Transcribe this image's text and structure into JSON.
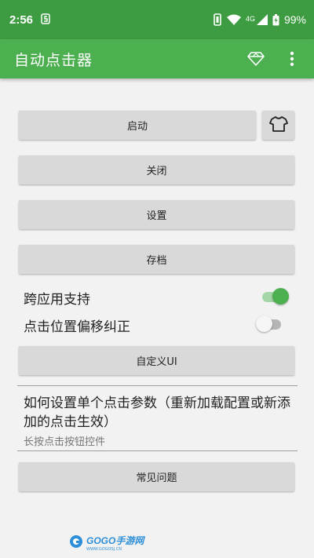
{
  "status_bar": {
    "time": "2:56",
    "notification_icon": "s-icon",
    "network": "4G",
    "battery": "99%",
    "icons": [
      "vibrate-icon",
      "wifi-icon",
      "signal-icon",
      "battery-icon"
    ]
  },
  "app_bar": {
    "title": "自动点击器",
    "actions": [
      "diamond-icon",
      "more-vert-icon"
    ],
    "color": "#4caf50",
    "status_color": "#3d9c41"
  },
  "buttons": {
    "start": "启动",
    "close": "关闭",
    "settings": "设置",
    "archive": "存档",
    "custom_ui": "自定义UI",
    "faq": "常见问题",
    "theme_icon": "tshirt-icon"
  },
  "toggles": {
    "cross_app": {
      "label": "跨应用支持",
      "on": true
    },
    "offset_fix": {
      "label": "点击位置偏移纠正",
      "on": false
    }
  },
  "info": {
    "title": "如何设置单个点击参数（重新加载配置或新添加的点击生效）",
    "subtitle": "长按点击按钮控件"
  },
  "watermark": {
    "brand": "GOGO手游网",
    "site": "WWW.GOGOSJ.CN"
  }
}
